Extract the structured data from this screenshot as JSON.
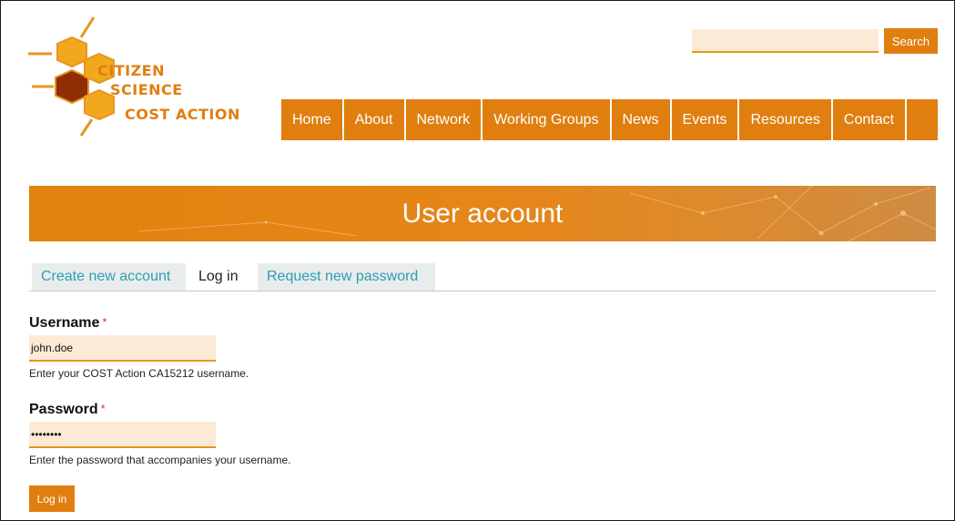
{
  "logo": {
    "line1": "CITIZEN",
    "line2": "SCIENCE",
    "line3": "COST ACTION"
  },
  "search": {
    "placeholder": "",
    "button_label": "Search"
  },
  "nav": {
    "items": [
      {
        "label": "Home"
      },
      {
        "label": "About"
      },
      {
        "label": "Network"
      },
      {
        "label": "Working Groups"
      },
      {
        "label": "News"
      },
      {
        "label": "Events"
      },
      {
        "label": "Resources"
      },
      {
        "label": "Contact"
      }
    ]
  },
  "banner": {
    "title": "User account"
  },
  "tabs": {
    "create": "Create new account",
    "login": "Log in",
    "request": "Request new password",
    "active": "login"
  },
  "form": {
    "username": {
      "label": "Username",
      "required_mark": "*",
      "value": "john.doe",
      "description": "Enter your COST Action CA15212 username."
    },
    "password": {
      "label": "Password",
      "required_mark": "*",
      "value": "password",
      "description": "Enter the password that accompanies your username."
    },
    "submit_label": "Log in"
  },
  "colors": {
    "accent": "#e07e10",
    "input_bg": "#fbead6",
    "tab_link": "#2b9fb4",
    "tab_bg": "#e9ecec",
    "required": "#e03030"
  }
}
